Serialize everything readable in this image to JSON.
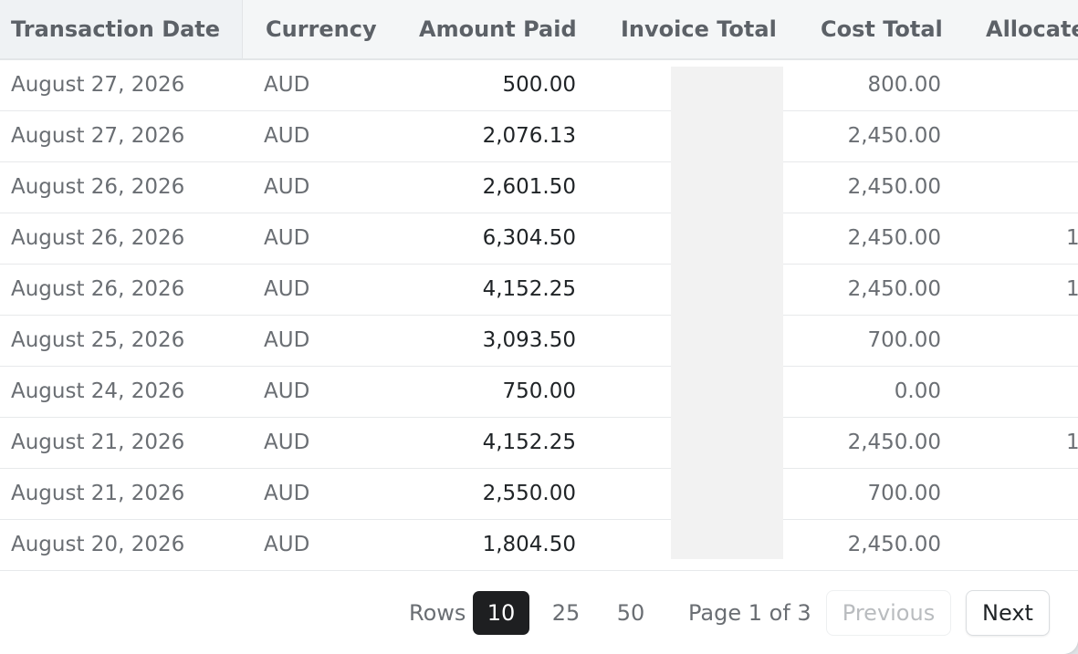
{
  "columns": [
    "Transaction Date",
    "Currency",
    "Amount Paid",
    "Invoice Total",
    "Cost Total",
    "Allocate"
  ],
  "rows": [
    {
      "date": "August 27, 2026",
      "currency": "AUD",
      "amount_paid": "500.00",
      "cost_total": "800.00",
      "allocated": ""
    },
    {
      "date": "August 27, 2026",
      "currency": "AUD",
      "amount_paid": "2,076.13",
      "cost_total": "2,450.00",
      "allocated": ""
    },
    {
      "date": "August 26, 2026",
      "currency": "AUD",
      "amount_paid": "2,601.50",
      "cost_total": "2,450.00",
      "allocated": ""
    },
    {
      "date": "August 26, 2026",
      "currency": "AUD",
      "amount_paid": "6,304.50",
      "cost_total": "2,450.00",
      "allocated": "1"
    },
    {
      "date": "August 26, 2026",
      "currency": "AUD",
      "amount_paid": "4,152.25",
      "cost_total": "2,450.00",
      "allocated": "1"
    },
    {
      "date": "August 25, 2026",
      "currency": "AUD",
      "amount_paid": "3,093.50",
      "cost_total": "700.00",
      "allocated": ""
    },
    {
      "date": "August 24, 2026",
      "currency": "AUD",
      "amount_paid": "750.00",
      "cost_total": "0.00",
      "allocated": ""
    },
    {
      "date": "August 21, 2026",
      "currency": "AUD",
      "amount_paid": "4,152.25",
      "cost_total": "2,450.00",
      "allocated": "1"
    },
    {
      "date": "August 21, 2026",
      "currency": "AUD",
      "amount_paid": "2,550.00",
      "cost_total": "700.00",
      "allocated": ""
    },
    {
      "date": "August 20, 2026",
      "currency": "AUD",
      "amount_paid": "1,804.50",
      "cost_total": "2,450.00",
      "allocated": ""
    }
  ],
  "pagination": {
    "rows_label": "Rows",
    "page_sizes": [
      "10",
      "25",
      "50"
    ],
    "selected_page_size": "10",
    "page_info": "Page 1 of 3",
    "previous_label": "Previous",
    "next_label": "Next"
  },
  "colors": {
    "active_page_size_bg": "#1e1f21",
    "header_bg": "#f4f6f7",
    "redaction": "#f2f2f2"
  }
}
